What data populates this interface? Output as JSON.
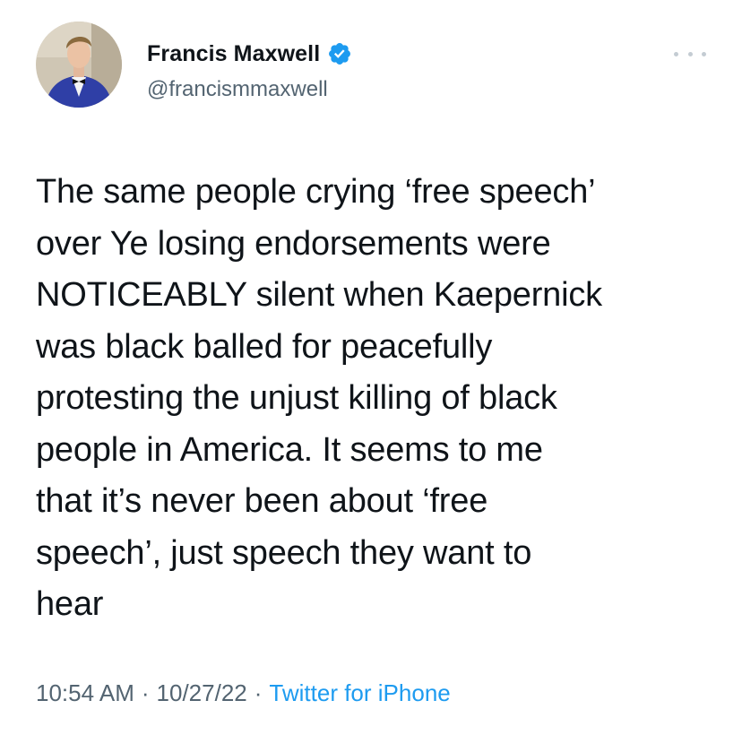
{
  "tweet": {
    "author": {
      "display_name": "Francis Maxwell",
      "handle": "@francismmaxwell",
      "verified": true,
      "avatar_icon": "profile-photo"
    },
    "text": "The same people crying ‘free speech’\nover Ye losing endorsements were\nNOTICEABLY silent when Kaepernick\nwas black balled for peacefully\nprotesting the unjust killing of black\npeople in America. It seems to me\nthat it’s never been about ‘free\nspeech’, just speech they want to\nhear",
    "time": "10:54 AM",
    "separator": "·",
    "date": "10/27/22",
    "source": "Twitter for iPhone",
    "more_icon": "more-horizontal-icon"
  },
  "colors": {
    "text_primary": "#0f1419",
    "text_secondary": "#536471",
    "link": "#1d9bf0",
    "verified_badge": "#1d9bf0"
  }
}
